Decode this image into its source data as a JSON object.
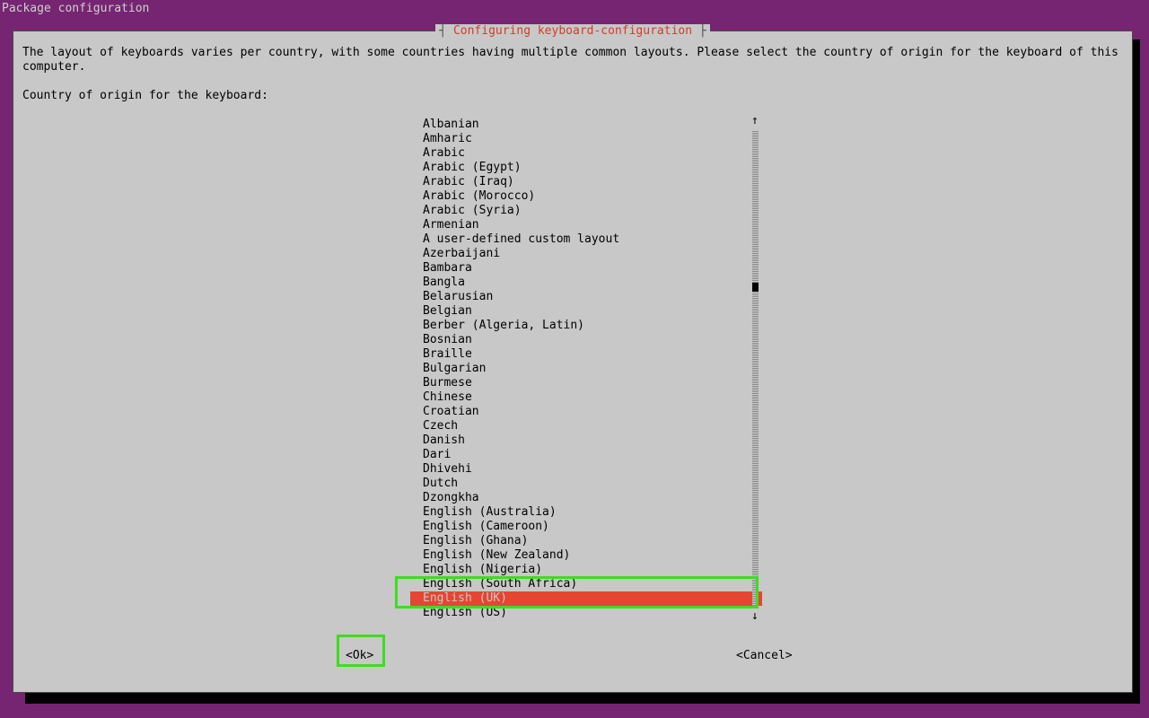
{
  "package_config_label": "Package configuration",
  "dialog": {
    "title_left_sep": "┤ ",
    "title": "Configuring keyboard-configuration",
    "title_right_sep": " ├",
    "body": "The layout of keyboards varies per country, with some countries having multiple common layouts. Please select the country of origin for the keyboard of this computer.",
    "prompt": "Country of origin for the keyboard:",
    "ok_label": "<Ok>",
    "cancel_label": "<Cancel>"
  },
  "list": {
    "selected_index": 33,
    "items": [
      "Albanian",
      "Amharic",
      "Arabic",
      "Arabic (Egypt)",
      "Arabic (Iraq)",
      "Arabic (Morocco)",
      "Arabic (Syria)",
      "Armenian",
      "A user-defined custom layout",
      "Azerbaijani",
      "Bambara",
      "Bangla",
      "Belarusian",
      "Belgian",
      "Berber (Algeria, Latin)",
      "Bosnian",
      "Braille",
      "Bulgarian",
      "Burmese",
      "Chinese",
      "Croatian",
      "Czech",
      "Danish",
      "Dari",
      "Dhivehi",
      "Dutch",
      "Dzongkha",
      "English (Australia)",
      "English (Cameroon)",
      "English (Ghana)",
      "English (New Zealand)",
      "English (Nigeria)",
      "English (South Africa)",
      "English (UK)",
      "English (US)"
    ]
  },
  "scroll_arrow_up": "↑",
  "scroll_arrow_down": "↓"
}
